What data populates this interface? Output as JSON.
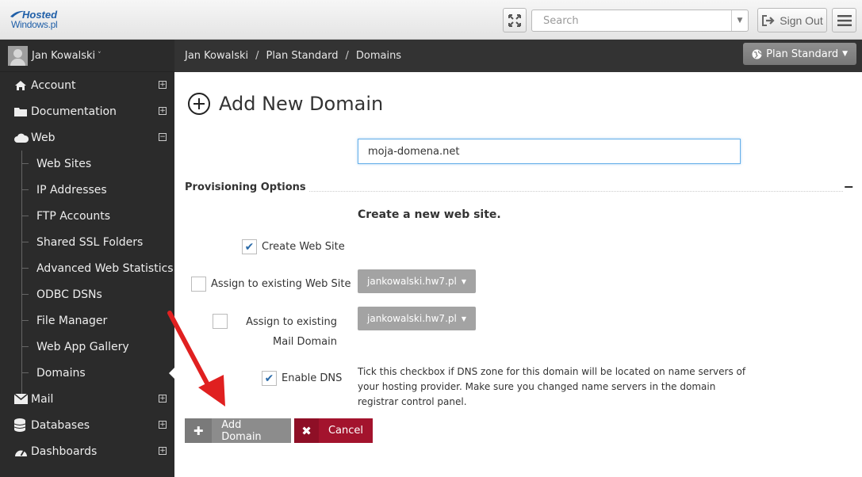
{
  "brand": {
    "line1": "Hosted",
    "line2": "Windows.pl",
    "color": "#1f5fa8"
  },
  "topbar": {
    "search_placeholder": "Search",
    "signout_label": "Sign Out",
    "icons": [
      "fullscreen-icon",
      "chevron-down-icon",
      "sign-out-icon",
      "hamburger-icon"
    ]
  },
  "user": {
    "name": "Jan Kowalski",
    "chevron": "˅"
  },
  "sidebar": {
    "items": [
      {
        "label": "Account",
        "icon": "home-icon",
        "toggle": "⊞"
      },
      {
        "label": "Documentation",
        "icon": "folder-icon",
        "toggle": "⊞"
      },
      {
        "label": "Web",
        "icon": "cloud-icon",
        "toggle": "⊟"
      }
    ],
    "web_children": [
      "Web Sites",
      "IP Addresses",
      "FTP Accounts",
      "Shared SSL Folders",
      "Advanced Web Statistics",
      "ODBC DSNs",
      "File Manager",
      "Web App Gallery",
      "Domains"
    ],
    "items_after": [
      {
        "label": "Mail",
        "icon": "envelope-icon",
        "toggle": "⊞"
      },
      {
        "label": "Databases",
        "icon": "database-icon",
        "toggle": "⊞"
      },
      {
        "label": "Dashboards",
        "icon": "dashboard-icon",
        "toggle": "⊞"
      }
    ]
  },
  "breadcrumb": {
    "items": [
      "Jan Kowalski",
      "Plan Standard",
      "Domains"
    ],
    "separator": "/"
  },
  "plan_button": {
    "label": "Plan Standard"
  },
  "page": {
    "title": "Add New Domain",
    "domain_value": "moja-domena.net",
    "section_title": "Provisioning Options",
    "collapse_symbol": "−",
    "subheading": "Create a new web site."
  },
  "options": {
    "create_web_site": {
      "label": "Create Web Site",
      "checked": true
    },
    "assign_existing_web_site": {
      "label": "Assign to existing Web Site",
      "checked": false,
      "select_value": "jankowalski.hw7.pl"
    },
    "assign_existing_mail_domain": {
      "label": "Assign to existing Mail Domain",
      "checked": false,
      "select_value": "jankowalski.hw7.pl"
    },
    "enable_dns": {
      "label": "Enable DNS",
      "checked": true,
      "help": "Tick this checkbox if DNS zone for this domain will be located on name servers of your hosting provider. Make sure you changed name servers in the domain registrar control panel."
    }
  },
  "buttons": {
    "add_domain": "Add Domain",
    "cancel": "Cancel"
  },
  "colors": {
    "sidebar_bg": "#2b2b2b",
    "accent_blue": "#66afe9",
    "cancel_red": "#a3132d",
    "arrow_red": "#e02020"
  }
}
